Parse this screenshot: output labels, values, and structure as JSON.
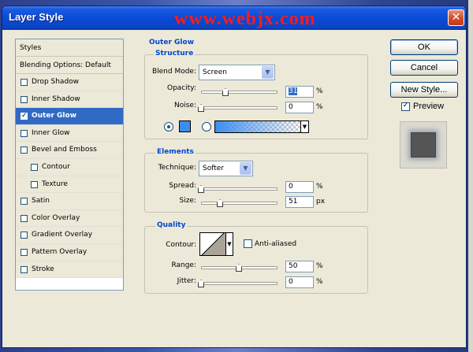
{
  "window": {
    "title": "Layer Style",
    "watermark": "www.webjx.com",
    "close_glyph": "✕"
  },
  "styles_panel": {
    "header": "Styles",
    "blending_default": "Blending Options: Default",
    "items": [
      {
        "label": "Drop Shadow",
        "checked": false,
        "indent": false,
        "active": false
      },
      {
        "label": "Inner Shadow",
        "checked": false,
        "indent": false,
        "active": false
      },
      {
        "label": "Outer Glow",
        "checked": true,
        "indent": false,
        "active": true
      },
      {
        "label": "Inner Glow",
        "checked": false,
        "indent": false,
        "active": false
      },
      {
        "label": "Bevel and Emboss",
        "checked": false,
        "indent": false,
        "active": false
      },
      {
        "label": "Contour",
        "checked": false,
        "indent": true,
        "active": false
      },
      {
        "label": "Texture",
        "checked": false,
        "indent": true,
        "active": false
      },
      {
        "label": "Satin",
        "checked": false,
        "indent": false,
        "active": false
      },
      {
        "label": "Color Overlay",
        "checked": false,
        "indent": false,
        "active": false
      },
      {
        "label": "Gradient Overlay",
        "checked": false,
        "indent": false,
        "active": false
      },
      {
        "label": "Pattern Overlay",
        "checked": false,
        "indent": false,
        "active": false
      },
      {
        "label": "Stroke",
        "checked": false,
        "indent": false,
        "active": false
      }
    ]
  },
  "outer_glow": {
    "title": "Outer Glow",
    "structure": {
      "title": "Structure",
      "blend_mode_label": "Blend Mode:",
      "blend_mode_value": "Screen",
      "opacity_label": "Opacity:",
      "opacity_value": "31",
      "opacity_unit": "%",
      "noise_label": "Noise:",
      "noise_value": "0",
      "noise_unit": "%",
      "glow_color": "#3c8df0"
    },
    "elements": {
      "title": "Elements",
      "technique_label": "Technique:",
      "technique_value": "Softer",
      "spread_label": "Spread:",
      "spread_value": "0",
      "spread_unit": "%",
      "size_label": "Size:",
      "size_value": "51",
      "size_unit": "px"
    },
    "quality": {
      "title": "Quality",
      "contour_label": "Contour:",
      "anti_aliased_label": "Anti-aliased",
      "range_label": "Range:",
      "range_value": "50",
      "range_unit": "%",
      "jitter_label": "Jitter:",
      "jitter_value": "0",
      "jitter_unit": "%"
    }
  },
  "buttons": {
    "ok": "OK",
    "cancel": "Cancel",
    "new_style": "New Style...",
    "preview_label": "Preview",
    "preview_checked": true
  }
}
